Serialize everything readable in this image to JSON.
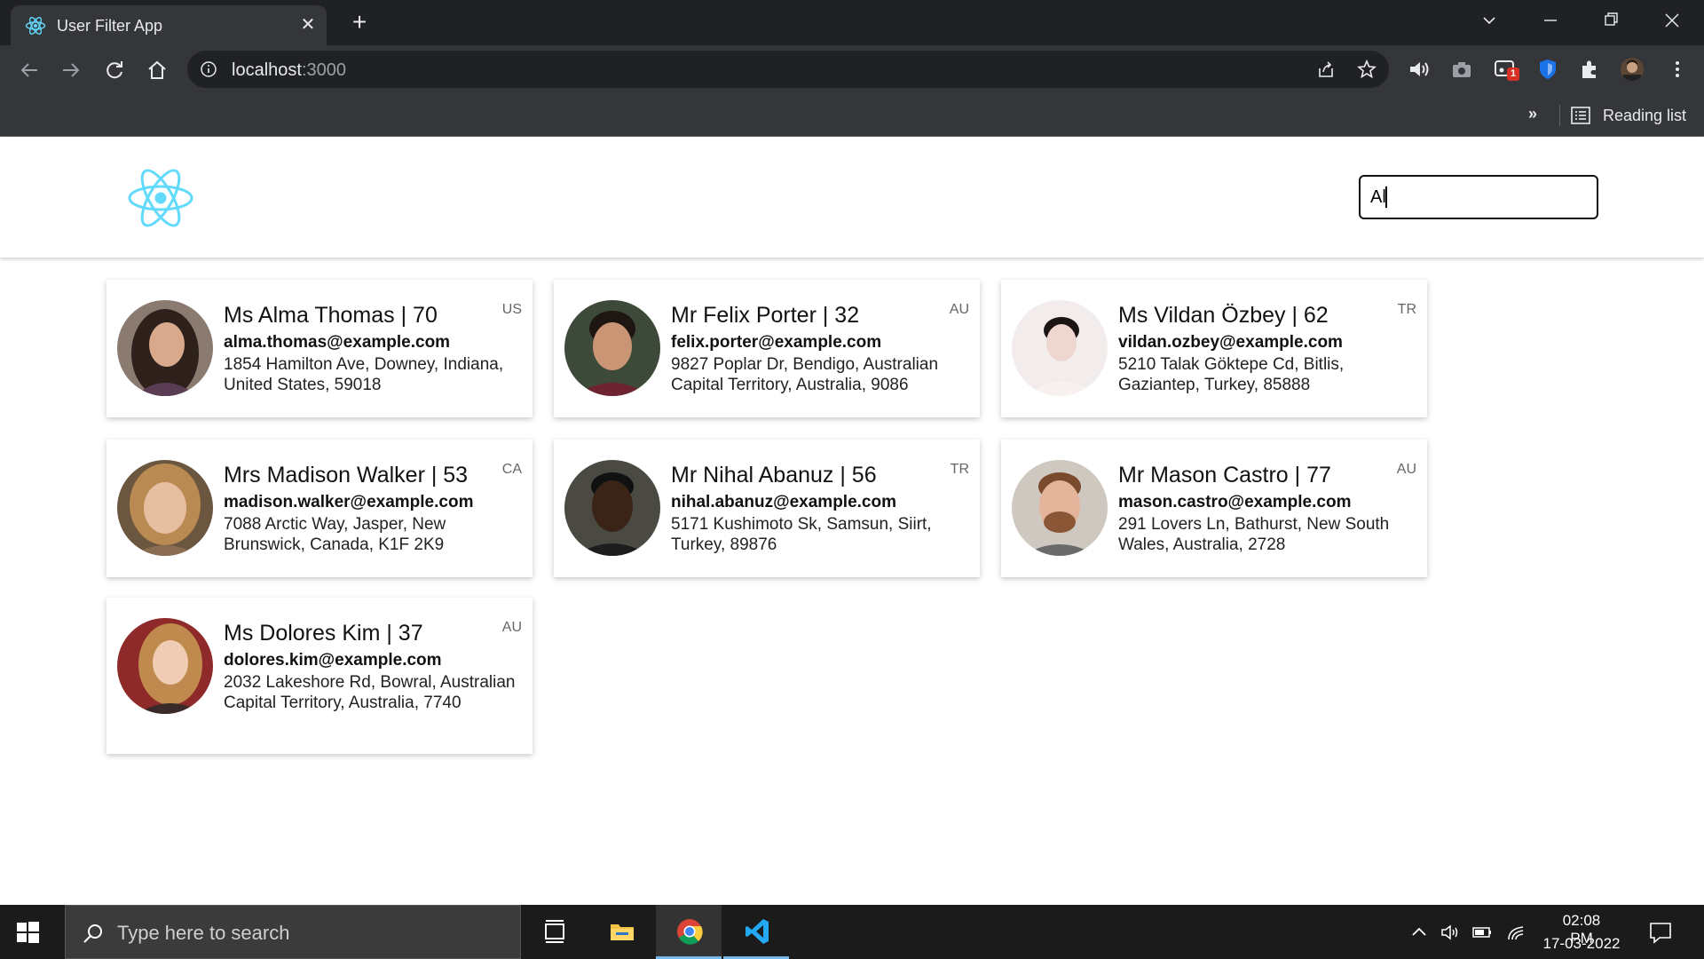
{
  "browser": {
    "tab_title": "User Filter App",
    "tab_close": "✕",
    "new_tab": "+",
    "address_host": "localhost",
    "address_port": ":3000",
    "reading_list_label": "Reading list",
    "bookmarks_overflow": "»",
    "extension_badge": "1"
  },
  "app": {
    "search_value": "Al",
    "brand_color": "#61dafb",
    "users": [
      {
        "name": "Ms Alma Thomas | 70",
        "email": "alma.thomas@example.com",
        "address": "1854 Hamilton Ave, Downey, Indiana, United States, 59018",
        "country": "US"
      },
      {
        "name": "Mr Felix Porter | 32",
        "email": "felix.porter@example.com",
        "address": "9827 Poplar Dr, Bendigo, Australian Capital Territory, Australia, 9086",
        "country": "AU"
      },
      {
        "name": "Ms Vildan Özbey | 62",
        "email": "vildan.ozbey@example.com",
        "address": "5210 Talak Göktepe Cd, Bitlis, Gaziantep, Turkey, 85888",
        "country": "TR"
      },
      {
        "name": "Mrs Madison Walker | 53",
        "email": "madison.walker@example.com",
        "address": "7088 Arctic Way, Jasper, New Brunswick, Canada, K1F 2K9",
        "country": "CA"
      },
      {
        "name": "Mr Nihal Abanuz | 56",
        "email": "nihal.abanuz@example.com",
        "address": "5171 Kushimoto Sk, Samsun, Siirt, Turkey, 89876",
        "country": "TR"
      },
      {
        "name": "Mr Mason Castro | 77",
        "email": "mason.castro@example.com",
        "address": "291 Lovers Ln, Bathurst, New South Wales, Australia, 2728",
        "country": "AU"
      },
      {
        "name": "Ms Dolores Kim | 37",
        "email": "dolores.kim@example.com",
        "address": "2032 Lakeshore Rd, Bowral, Australian Capital Territory, Australia, 7740",
        "country": "AU"
      }
    ]
  },
  "taskbar": {
    "search_placeholder": "Type here to search",
    "time": "02:08 PM",
    "date": "17-03-2022",
    "apps": [
      "task-view",
      "file-explorer",
      "chrome",
      "vscode"
    ]
  }
}
